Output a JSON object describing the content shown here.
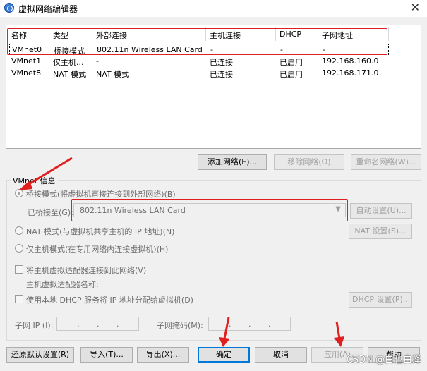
{
  "window": {
    "title": "虚拟网络编辑器",
    "close_glyph": "✕"
  },
  "table": {
    "headers": [
      "名称",
      "类型",
      "外部连接",
      "主机连接",
      "DHCP",
      "子网地址"
    ],
    "rows": [
      [
        "VMnet0",
        "桥接模式",
        "802.11n Wireless LAN Card",
        "-",
        "-",
        "-"
      ],
      [
        "VMnet1",
        "仅主机...",
        "-",
        "已连接",
        "已启用",
        "192.168.160.0"
      ],
      [
        "VMnet8",
        "NAT 模式",
        "NAT 模式",
        "已连接",
        "已启用",
        "192.168.171.0"
      ]
    ]
  },
  "buttons": {
    "add_network": "添加网络(E)...",
    "remove_network": "移除网络(O)",
    "rename_network": "重命名网络(W)...",
    "auto_settings": "自动设置(U)...",
    "nat_settings": "NAT 设置(S)...",
    "dhcp_settings": "DHCP 设置(P)...",
    "restore_defaults": "还原默认设置(R)",
    "import": "导入(T)...",
    "export": "导出(X)...",
    "ok": "确定",
    "cancel": "取消",
    "apply": "应用(A)",
    "help": "帮助"
  },
  "vmnet_info": {
    "legend": "VMnet 信息",
    "bridged": "桥接模式(将虚拟机直接连接到外部网络)(B)",
    "bridged_to_label": "已桥接至(G):",
    "bridged_to_value": "802.11n Wireless LAN Card",
    "nat": "NAT 模式(与虚拟机共享主机的 IP 地址)(N)",
    "host_only": "仅主机模式(在专用网络内连接虚拟机)(H)",
    "connect_adapter": "将主机虚拟适配器连接到此网络(V)",
    "adapter_name_label": "主机虚拟适配器名称:",
    "use_dhcp": "使用本地 DHCP 服务将 IP 地址分配给虚拟机(D)",
    "subnet_ip_label": "子网 IP (I):",
    "subnet_mask_label": "子网掩码(M):",
    "ip_dot": "."
  },
  "watermark": "CSDN @白也白泽",
  "colors": {
    "annotation_red": "#e02020",
    "accent_blue": "#0078d7"
  }
}
